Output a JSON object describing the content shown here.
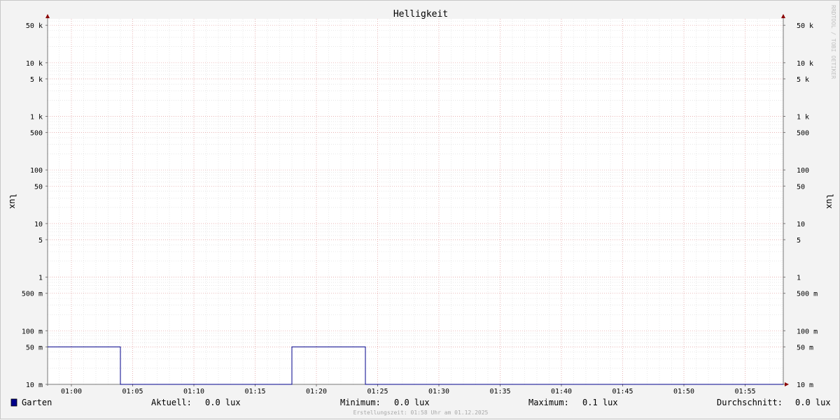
{
  "chart_data": {
    "type": "line",
    "title": "Helligkeit",
    "ylabel": "lux",
    "y_scale": "log",
    "ylim": [
      0.01,
      80000
    ],
    "y_ticks": [
      {
        "value": 50000,
        "label": "50 k"
      },
      {
        "value": 10000,
        "label": "10 k"
      },
      {
        "value": 5000,
        "label": "5 k"
      },
      {
        "value": 1000,
        "label": "1 k"
      },
      {
        "value": 500,
        "label": "500"
      },
      {
        "value": 100,
        "label": "100"
      },
      {
        "value": 50,
        "label": "50"
      },
      {
        "value": 10,
        "label": "10"
      },
      {
        "value": 5,
        "label": "5"
      },
      {
        "value": 1,
        "label": "1"
      },
      {
        "value": 0.5,
        "label": "500 m"
      },
      {
        "value": 0.1,
        "label": "100 m"
      },
      {
        "value": 0.05,
        "label": "50 m"
      },
      {
        "value": 0.01,
        "label": "10 m"
      }
    ],
    "xlim": [
      "00:58",
      "02:00"
    ],
    "x_ticks": [
      "01:00",
      "01:05",
      "01:10",
      "01:15",
      "01:20",
      "01:25",
      "01:30",
      "01:35",
      "01:40",
      "01:45",
      "01:50",
      "01:55"
    ],
    "grid": true,
    "series": [
      {
        "name": "Garten",
        "color": "#00008b",
        "points": [
          {
            "time": "00:58",
            "value": 0.05
          },
          {
            "time": "01:04",
            "value": 0.05
          },
          {
            "time": "01:04",
            "value": 0.01
          },
          {
            "time": "01:18",
            "value": 0.01
          },
          {
            "time": "01:18",
            "value": 0.05
          },
          {
            "time": "01:24",
            "value": 0.05
          },
          {
            "time": "01:24",
            "value": 0.01
          },
          {
            "time": "02:00",
            "value": 0.01
          }
        ]
      }
    ],
    "legend": {
      "placement": "bottom",
      "series_name": "Garten",
      "stats": [
        {
          "label": "Aktuell:",
          "value": "0.0 lux"
        },
        {
          "label": "Minimum:",
          "value": "0.0 lux"
        },
        {
          "label": "Maximum:",
          "value": "0.1 lux"
        },
        {
          "label": "Durchschnitt:",
          "value": "0.0 lux"
        }
      ]
    },
    "watermark": "RRDTOOL / TOBI OETIKER",
    "footer": "Erstellungszeit: 01:58 Uhr am 01.12.2025"
  }
}
